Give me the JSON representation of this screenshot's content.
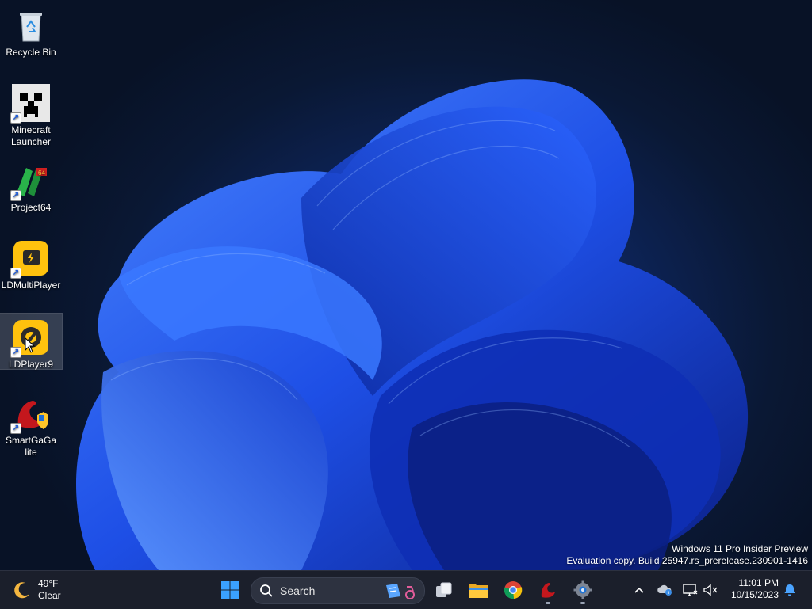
{
  "desktop": {
    "icons": [
      {
        "label": "Recycle Bin",
        "icon": "recycle-bin-icon"
      },
      {
        "label": "Minecraft Launcher",
        "icon": "minecraft-icon"
      },
      {
        "label": "Project64",
        "icon": "project64-icon"
      },
      {
        "label": "LDMultiPlayer",
        "icon": "ldmultiplayer-icon"
      },
      {
        "label": "LDPlayer9",
        "icon": "ldplayer-icon",
        "selected": true
      },
      {
        "label": "SmartGaGa lite",
        "icon": "smartgaga-icon"
      }
    ],
    "watermark": {
      "line1": "Windows 11 Pro Insider Preview",
      "line2": "Evaluation copy. Build 25947.rs_prerelease.230901-1416"
    }
  },
  "taskbar": {
    "weather": {
      "temp": "49°F",
      "condition": "Clear",
      "icon": "moon-icon"
    },
    "search_placeholder": "Search",
    "apps": [
      "start-icon",
      "search-icon",
      "task-view-icon",
      "file-explorer-icon",
      "chrome-icon",
      "smartgaga-icon",
      "settings-icon"
    ],
    "tray": [
      "chevron-up-icon",
      "onedrive-icon",
      "network-icon",
      "volume-muted-icon"
    ],
    "clock": {
      "time": "11:01 PM",
      "date": "10/15/2023"
    },
    "notification_icon": "bell-icon"
  },
  "colors": {
    "accent": "#1e5bff",
    "taskbar": "#1b1f2b"
  }
}
